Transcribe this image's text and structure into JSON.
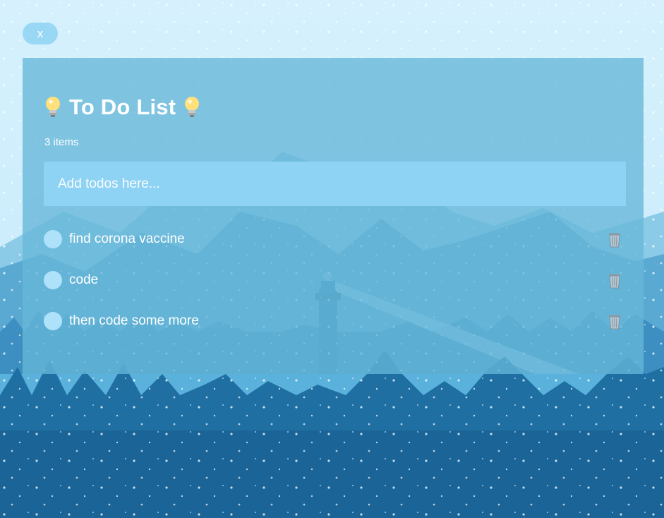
{
  "close_button": {
    "label": "x"
  },
  "header": {
    "title": "To Do List",
    "leading_icon": "light-bulb-icon",
    "trailing_icon": "light-bulb-icon"
  },
  "count": {
    "text": "3 items"
  },
  "new_todo": {
    "placeholder": "Add todos here...",
    "value": ""
  },
  "todos": [
    {
      "text": "find corona vaccine",
      "done": false,
      "delete_icon": "trash-can-icon"
    },
    {
      "text": "code",
      "done": false,
      "delete_icon": "trash-can-icon"
    },
    {
      "text": "then code some more",
      "done": false,
      "delete_icon": "trash-can-icon"
    }
  ],
  "colors": {
    "page_background": "#d6f1fd",
    "panel": "#67b7d8",
    "input": "#8fd3f4",
    "checkbox": "#aee2fb",
    "close_button": "#98d8f5",
    "text": "#ffffff"
  }
}
